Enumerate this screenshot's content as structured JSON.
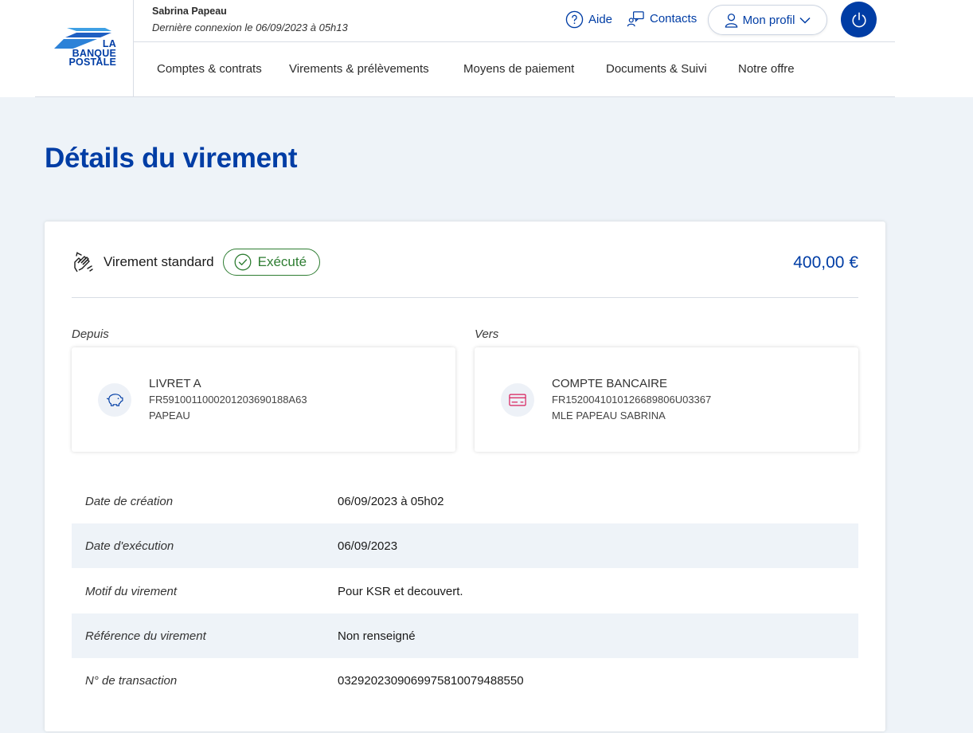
{
  "brand": {
    "logo_text_line1": "LA",
    "logo_text_line2": "BANQUE",
    "logo_text_line3": "POSTALE",
    "primary_color": "#003da5"
  },
  "user": {
    "name": "Sabrina Papeau",
    "last_login": "Dernière connexion le 06/09/2023 à 05h13"
  },
  "top_links": {
    "aide": "Aide",
    "contacts": "Contacts",
    "profil": "Mon profil"
  },
  "nav": [
    "Comptes & contrats",
    "Virements & prélèvements",
    "Moyens de paiement",
    "Documents & Suivi",
    "Notre offre"
  ],
  "page": {
    "title": "Détails du virement"
  },
  "transfer": {
    "type": "Virement standard",
    "status": "Exécuté",
    "status_color": "#2e7d32",
    "amount": "400,00 €"
  },
  "from": {
    "label": "Depuis",
    "title": "LIVRET A",
    "iban": "FR5910011000201203690188A63",
    "owner": "PAPEAU",
    "icon": "piggy-bank-icon"
  },
  "to": {
    "label": "Vers",
    "title": "COMPTE BANCAIRE",
    "iban": "FR1520041010126689806U03367",
    "owner": "MLE PAPEAU SABRINA",
    "icon": "credit-card-icon"
  },
  "details": [
    {
      "key": "Date de création",
      "value": "06/09/2023 à 05h02"
    },
    {
      "key": "Date d'exécution",
      "value": "06/09/2023"
    },
    {
      "key": "Motif du virement",
      "value": "Pour KSR et decouvert."
    },
    {
      "key": "Référence du virement",
      "value": "Non renseigné"
    },
    {
      "key": "N° de transaction",
      "value": "03292023090699758100794885​50"
    }
  ]
}
